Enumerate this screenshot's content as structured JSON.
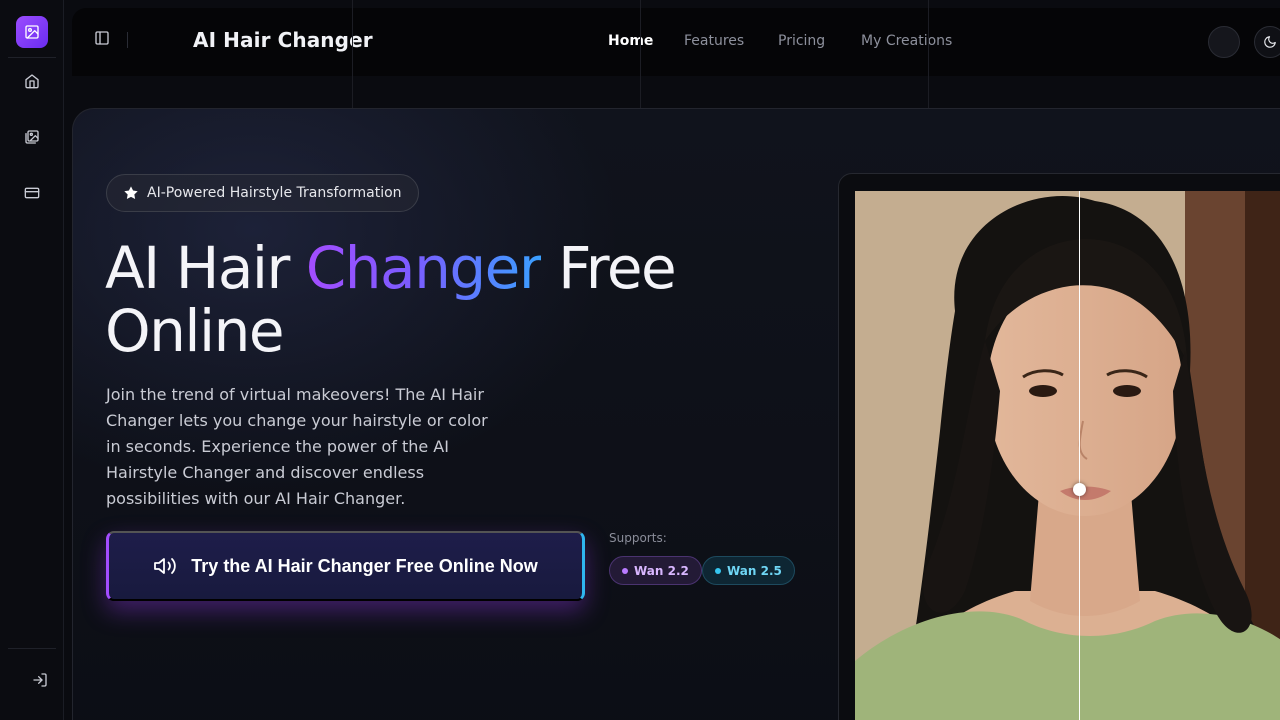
{
  "app": {
    "title": "AI Hair Changer"
  },
  "sidebar": {
    "items": [
      {
        "icon": "home-icon"
      },
      {
        "icon": "gallery-icon"
      },
      {
        "icon": "credit-card-icon"
      }
    ],
    "login_icon": "login-icon"
  },
  "nav": {
    "items": [
      {
        "label": "Home",
        "active": true
      },
      {
        "label": "Features",
        "active": false
      },
      {
        "label": "Pricing",
        "active": false
      },
      {
        "label": "My Creations",
        "active": false
      }
    ]
  },
  "hero": {
    "badge": "AI-Powered Hairstyle Transformation",
    "headline_part1": "AI Hair ",
    "headline_highlight": "Changer",
    "headline_part2": " Free Online",
    "description": "Join the trend of virtual makeovers! The AI Hair Changer lets you change your hairstyle or color in seconds. Experience the power of the AI Hairstyle Changer and discover endless possibilities with our AI Hair Changer.",
    "cta_label": "Try the AI Hair Changer Free Online Now",
    "supports_label": "Supports:",
    "models": [
      "Wan 2.2",
      "Wan 2.5"
    ]
  },
  "colors": {
    "accent_purple": "#a44dff",
    "accent_blue": "#3aa0ff",
    "background": "#0a0b10"
  }
}
